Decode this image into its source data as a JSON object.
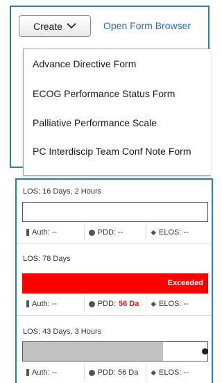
{
  "toolbar": {
    "create_label": "Create",
    "open_form_browser": "Open Form Browser"
  },
  "create_menu": {
    "items": [
      "Advance Directive Form",
      "ECOG Performance Status Form",
      "Palliative Performance Scale",
      "PC Interdiscip Team Conf Note Form"
    ]
  },
  "stays": [
    {
      "los": "LOS: 16 Days, 2 Hours",
      "progress": 0,
      "exceeded": false,
      "auth": "Auth: --",
      "pdd": "PDD: --",
      "elos": "ELOS: --"
    },
    {
      "los": "LOS: 78 Days",
      "progress": 1,
      "exceeded": true,
      "exceeded_label": "Exceeded",
      "auth": "Auth: --",
      "pdd_label": "PDD:",
      "pdd_value": "56 Da",
      "elos": "ELOS: --"
    },
    {
      "los": "LOS: 43 Days, 3 Hours",
      "progress": 0.76,
      "exceeded": false,
      "auth": "Auth: --",
      "pdd": "PDD: 56 Da",
      "elos": "ELOS: --"
    }
  ],
  "colors": {
    "panel_border": "#2b7f9c",
    "link": "#1f6fae",
    "exceeded": "#ff0000",
    "pdd_alert": "#d41f1f",
    "progress_fill": "#c0c0c0"
  }
}
